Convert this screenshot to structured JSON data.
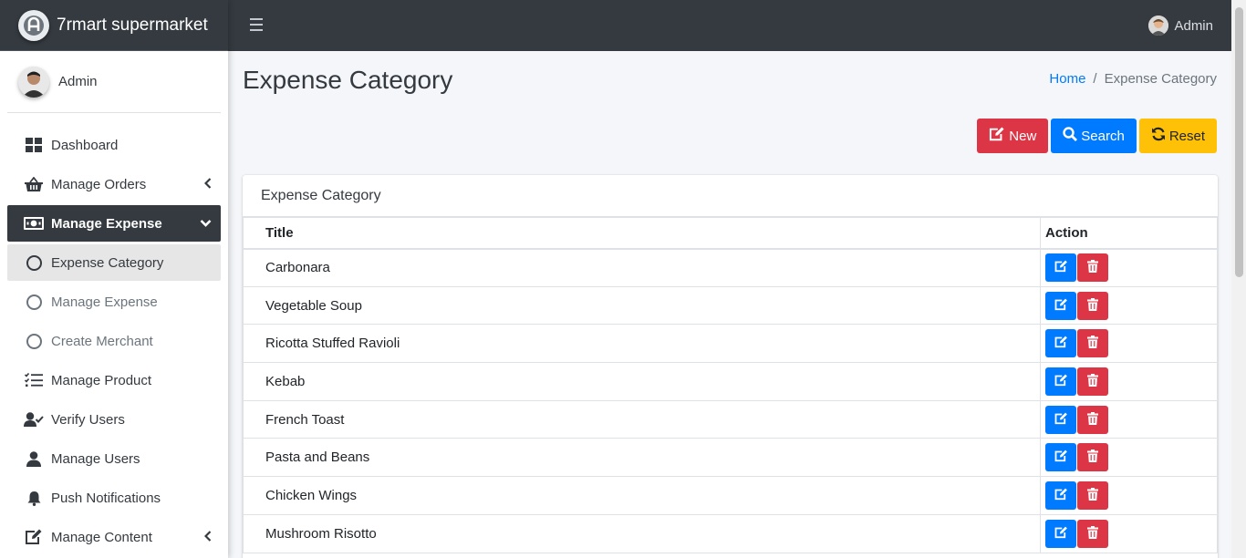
{
  "brand": {
    "name": "7rmart supermarket"
  },
  "topbar": {
    "user": "Admin"
  },
  "sidebar": {
    "user": "Admin",
    "items": [
      {
        "label": "Dashboard",
        "icon": "dashboard-icon"
      },
      {
        "label": "Manage Orders",
        "icon": "basket-icon"
      },
      {
        "label": "Manage Expense",
        "icon": "money-icon"
      },
      {
        "label": "Expense Category",
        "icon": "circle-icon"
      },
      {
        "label": "Manage Expense",
        "icon": "circle-icon"
      },
      {
        "label": "Create Merchant",
        "icon": "circle-icon"
      },
      {
        "label": "Manage Product",
        "icon": "tasks-icon"
      },
      {
        "label": "Verify Users",
        "icon": "user-check-icon"
      },
      {
        "label": "Manage Users",
        "icon": "user-icon"
      },
      {
        "label": "Push Notifications",
        "icon": "bell-icon"
      },
      {
        "label": "Manage Content",
        "icon": "edit-icon"
      }
    ]
  },
  "page": {
    "title": "Expense Category",
    "breadcrumb": {
      "home": "Home",
      "sep": "/",
      "current": "Expense Category"
    }
  },
  "buttons": {
    "new": "New",
    "search": "Search",
    "reset": "Reset"
  },
  "colors": {
    "sidebar_dark": "#343a40",
    "primary": "#007bff",
    "danger": "#dc3545",
    "warning": "#ffc107"
  },
  "card": {
    "title": "Expense Category",
    "columns": [
      "Title",
      "Action"
    ],
    "rows": [
      "Carbonara",
      "Vegetable Soup",
      "Ricotta Stuffed Ravioli",
      "Kebab",
      "French Toast",
      "Pasta and Beans",
      "Chicken Wings",
      "Mushroom Risotto"
    ]
  }
}
